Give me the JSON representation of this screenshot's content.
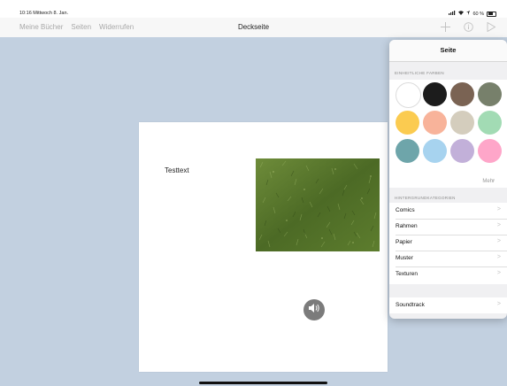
{
  "status_bar": {
    "time": "10:16",
    "date": "Mittwoch 8. Jan.",
    "battery": "60 %"
  },
  "nav": {
    "left_items": [
      "Meine Bücher",
      "Seiten",
      "Widerrufen"
    ],
    "title": "Deckseite",
    "icons": [
      "plus-icon",
      "info-icon",
      "play-icon"
    ]
  },
  "page": {
    "text": "Testtext",
    "image_alt": "grass-photo",
    "sound_icon": "speaker-icon"
  },
  "popover": {
    "title": "Seite",
    "colors_label": "EINHEITLICHE FARBEN",
    "colors": [
      "#ffffff",
      "#1c1c1c",
      "#7a6353",
      "#77806b",
      "#fbcb50",
      "#f8b39a",
      "#d4cdbd",
      "#a2dbb4",
      "#6ea5aa",
      "#a7d3ef",
      "#c2b0d9",
      "#fea6c9"
    ],
    "more_label": "Mehr",
    "categories_label": "HINTERGRUNDKATEGORIEN",
    "categories": [
      "Comics",
      "Rahmen",
      "Papier",
      "Muster",
      "Texturen"
    ],
    "soundtrack_label": "Soundtrack",
    "chevron": ">"
  }
}
